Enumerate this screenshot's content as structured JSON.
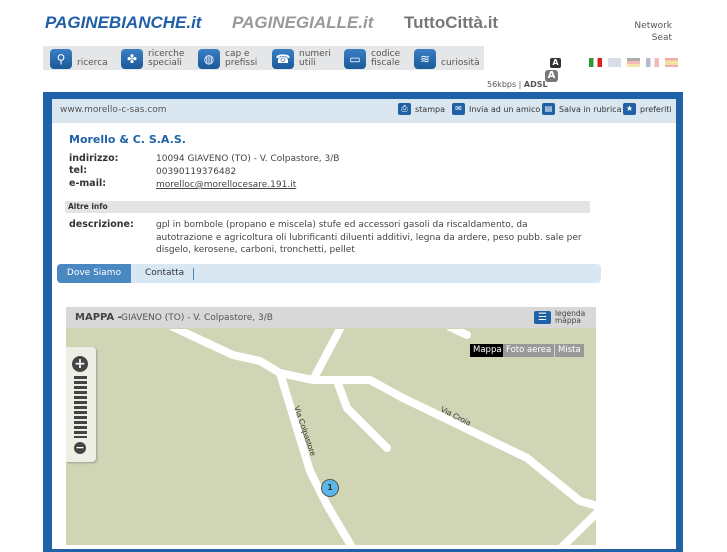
{
  "header": {
    "logos": [
      "PAGINEBIANCHE.it",
      "PAGINEGIALLE.it",
      "TuttoCittà.it"
    ],
    "network": "Network",
    "seat": "Seat",
    "speed_56": "56kbps",
    "speed_adsl": "ADSL",
    "font_small": "A",
    "font_large": "A"
  },
  "nav": [
    {
      "label1": "",
      "label2": "ricerca",
      "icon": "search-icon"
    },
    {
      "label1": "ricerche",
      "label2": "speciali",
      "icon": "clover-icon"
    },
    {
      "label1": "cap e",
      "label2": "prefissi",
      "icon": "globe-icon"
    },
    {
      "label1": "numeri",
      "label2": "utili",
      "icon": "phone-icon"
    },
    {
      "label1": "codice",
      "label2": "fiscale",
      "icon": "card-icon"
    },
    {
      "label1": "",
      "label2": "curiosità",
      "icon": "scroll-icon"
    }
  ],
  "languages": [
    "it",
    "en",
    "de",
    "fr",
    "es"
  ],
  "toolbar": {
    "website": "www.morello-c-sas.com",
    "print": "stampa",
    "send": "Invia ad un amico",
    "save": "Salva in rubrica",
    "favorites": "preferiti"
  },
  "company": {
    "name": "Morello & C. S.A.S.",
    "address_label": "indirizzo:",
    "address": "10094 GIAVENO (TO) - V. Colpastore, 3/B",
    "tel_label": "tel:",
    "tel": "00390119376482",
    "email_label": "e-mail:",
    "email": "morelloc@morellocesare.191.it"
  },
  "more": {
    "title": "Altre info",
    "desc_label": "descrizione:",
    "description": "gpl in bombole (propano e miscela) stufe ed accessori gasoli da riscaldamento, da autotrazione e agricoltura oli lubrificanti diluenti additivi, legna da ardere, peso pubb. sale per disgelo, kerosene, carboni, tronchetti, pellet"
  },
  "tabs": [
    "Dove Siamo",
    "Contatta"
  ],
  "map": {
    "title": "MAPPA -",
    "address": "GIAVENO (TO) - V. Colpastore, 3/B",
    "legend1": "legenda",
    "legend2": "mappa",
    "modes": [
      "Mappa",
      "Foto aerea",
      "Mista"
    ],
    "street1": "Via Colpastore",
    "street2": "Via Croia",
    "marker": "1"
  }
}
